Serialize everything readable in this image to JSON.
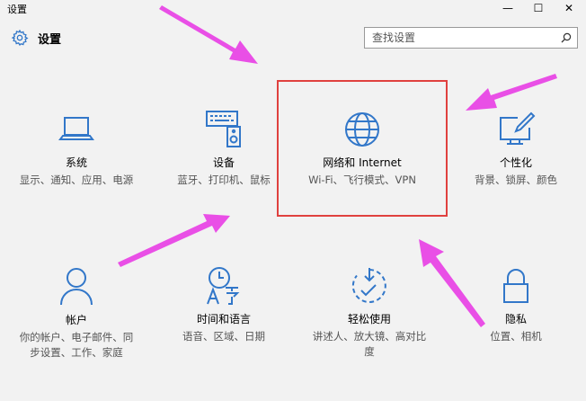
{
  "window": {
    "title": "设置",
    "minimize_glyph": "—",
    "maximize_glyph": "☐",
    "close_glyph": "✕"
  },
  "header": {
    "title": "设置",
    "icon": "gear-icon"
  },
  "search": {
    "placeholder": "查找设置",
    "icon": "search-icon"
  },
  "tiles": [
    {
      "name": "系统",
      "desc": "显示、通知、应用、电源",
      "icon": "laptop-icon"
    },
    {
      "name": "设备",
      "desc": "蓝牙、打印机、鼠标",
      "icon": "keyboard-speaker-icon"
    },
    {
      "name": "网络和 Internet",
      "desc": "Wi-Fi、飞行模式、VPN",
      "icon": "globe-icon"
    },
    {
      "name": "个性化",
      "desc": "背景、锁屏、颜色",
      "icon": "monitor-pen-icon"
    },
    {
      "name": "帐户",
      "desc": "你的帐户、电子邮件、同步设置、工作、家庭",
      "icon": "person-icon"
    },
    {
      "name": "时间和语言",
      "desc": "语音、区域、日期",
      "icon": "clock-language-icon"
    },
    {
      "name": "轻松使用",
      "desc": "讲述人、放大镜、高对比度",
      "icon": "ease-of-access-icon"
    },
    {
      "name": "隐私",
      "desc": "位置、相机",
      "icon": "lock-icon"
    }
  ],
  "colors": {
    "accent": "#3277c9",
    "annotation_arrow": "#e94fe6",
    "highlight_box": "#e0413f"
  }
}
